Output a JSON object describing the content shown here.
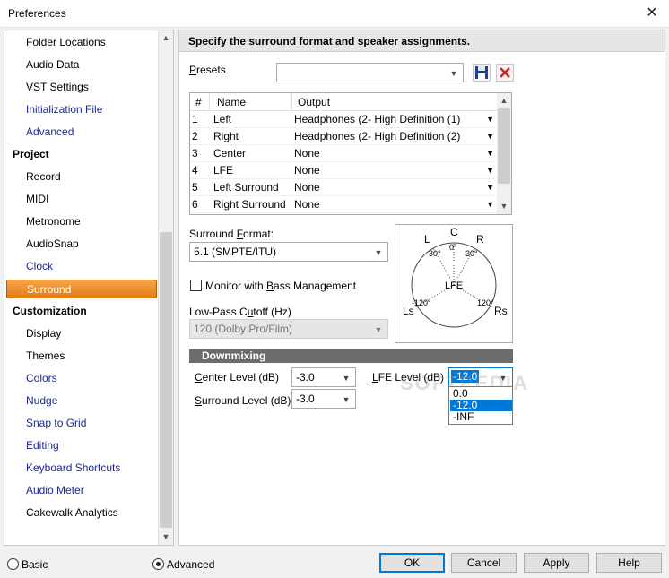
{
  "window": {
    "title": "Preferences"
  },
  "tree": {
    "items_top": [
      {
        "label": "Folder Locations",
        "link": false
      },
      {
        "label": "Audio Data",
        "link": false
      },
      {
        "label": "VST Settings",
        "link": false
      },
      {
        "label": "Initialization File",
        "link": true
      },
      {
        "label": "Advanced",
        "link": true
      }
    ],
    "cat_project": "Project",
    "items_project": [
      {
        "label": "Record",
        "link": false
      },
      {
        "label": "MIDI",
        "link": false
      },
      {
        "label": "Metronome",
        "link": false
      },
      {
        "label": "AudioSnap",
        "link": false
      },
      {
        "label": "Clock",
        "link": true
      },
      {
        "label": "Surround",
        "link": false,
        "selected": true
      }
    ],
    "cat_customization": "Customization",
    "items_custom": [
      {
        "label": "Display",
        "link": false
      },
      {
        "label": "Themes",
        "link": false
      },
      {
        "label": "Colors",
        "link": true
      },
      {
        "label": "Nudge",
        "link": true
      },
      {
        "label": "Snap to Grid",
        "link": true
      },
      {
        "label": "Editing",
        "link": true
      },
      {
        "label": "Keyboard Shortcuts",
        "link": true
      },
      {
        "label": "Audio Meter",
        "link": true
      },
      {
        "label": "Cakewalk Analytics",
        "link": false
      }
    ]
  },
  "header": {
    "text": "Specify the surround format and speaker assignments."
  },
  "presets": {
    "label": "Presets",
    "value": ""
  },
  "grid": {
    "columns": [
      "#",
      "Name",
      "Output"
    ],
    "rows": [
      {
        "num": "1",
        "name": "Left",
        "output": "Headphones (2- High Definition  (1)"
      },
      {
        "num": "2",
        "name": "Right",
        "output": "Headphones (2- High Definition  (2)"
      },
      {
        "num": "3",
        "name": "Center",
        "output": "None"
      },
      {
        "num": "4",
        "name": "LFE",
        "output": "None"
      },
      {
        "num": "5",
        "name": "Left Surround",
        "output": "None"
      },
      {
        "num": "6",
        "name": "Right Surround",
        "output": "None"
      }
    ]
  },
  "surround_format": {
    "label": "Surround Format:",
    "value": "5.1 (SMPTE/ITU)"
  },
  "monitor": {
    "label": "Monitor with Bass Management",
    "checked": false
  },
  "lowpass": {
    "label": "Low-Pass Cutoff (Hz)",
    "value": "120 (Dolby Pro/Film)"
  },
  "diagram": {
    "c": "C",
    "l": "L",
    "r": "R",
    "lfe": "LFE",
    "ls": "Ls",
    "rs": "Rs",
    "a0": "0°",
    "a_l": "-30°",
    "a_r": "30°",
    "a_ls": "-120°",
    "a_rs": "120°"
  },
  "downmix": {
    "title": "Downmixing",
    "center_label": "Center Level (dB)",
    "center_value": "-3.0",
    "surround_label": "Surround Level (dB)",
    "surround_value": "-3.0",
    "lfe_label": "LFE Level (dB)",
    "lfe_value": "-12.0",
    "lfe_options": [
      "0.0",
      "-12.0",
      "-INF"
    ],
    "lfe_selected_index": 1
  },
  "watermark": "SOFTPEDIA",
  "mode": {
    "basic": "Basic",
    "advanced": "Advanced",
    "selected": "advanced"
  },
  "buttons": {
    "ok": "OK",
    "cancel": "Cancel",
    "apply": "Apply",
    "help": "Help"
  },
  "colors": {
    "accent": "#0078d7",
    "selected_tree": "#e88a22"
  }
}
